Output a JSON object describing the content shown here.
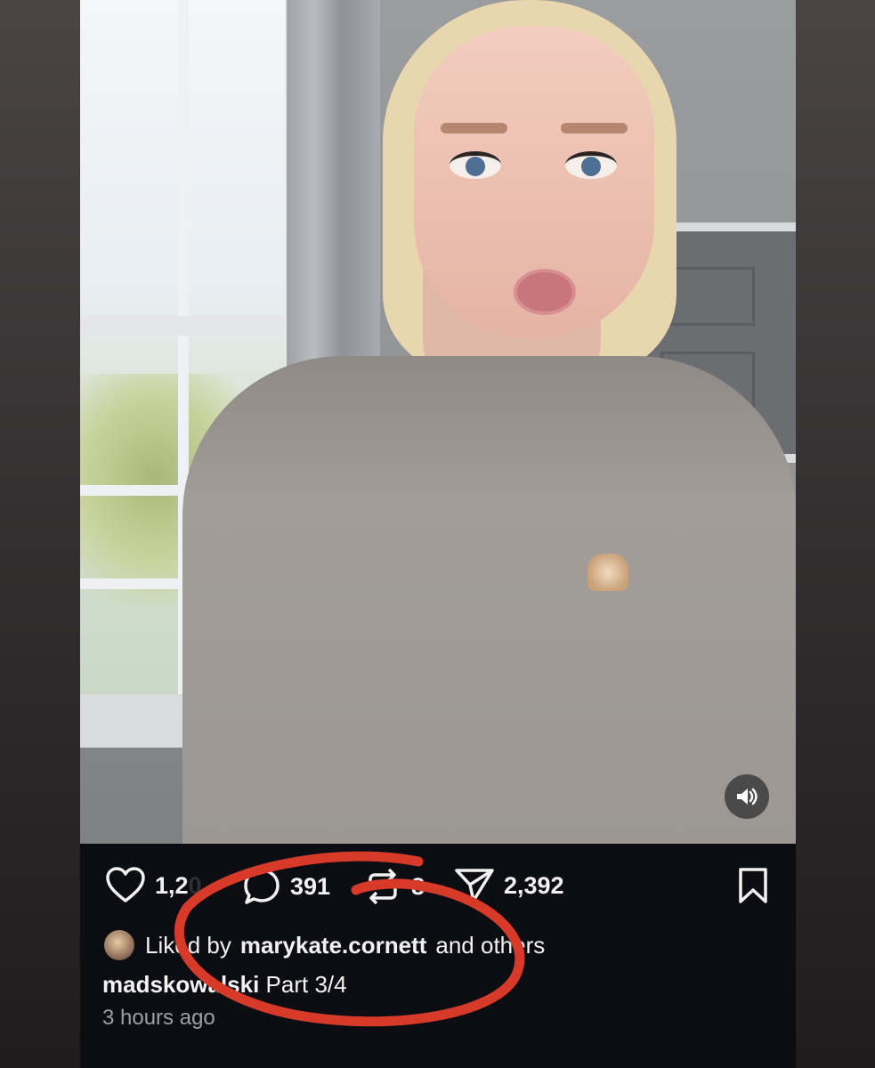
{
  "post": {
    "actions": {
      "like_count": "1,2",
      "like_count_tail": "0",
      "comment_count": "391",
      "repost_count": "8",
      "share_count": "2,392"
    },
    "liked_by": {
      "prefix": "Liked by",
      "username": "marykate.cornett",
      "suffix": "and others"
    },
    "caption": {
      "username": "madskowalski",
      "text": "Part 3/4"
    },
    "timestamp": "3 hours ago"
  },
  "annotation": {
    "color": "#d83a2a"
  },
  "icons": {
    "like": "heart-icon",
    "comment": "comment-bubble-icon",
    "repost": "repost-icon",
    "share": "send-icon",
    "bookmark": "bookmark-icon",
    "sound": "speaker-icon"
  }
}
